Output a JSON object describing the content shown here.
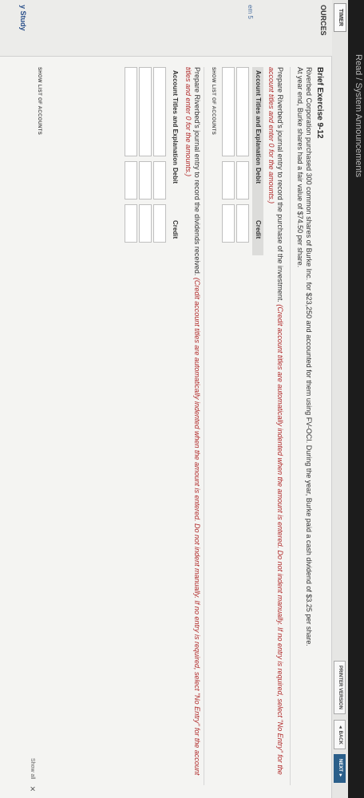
{
  "top": {
    "heading": "",
    "sub": "Read / System Announcements"
  },
  "header": {
    "timer": "TIMER",
    "printer": "PRINTER VERSION",
    "back": "◄ BACK",
    "next": "NEXT ►"
  },
  "sidebar": {
    "resources": "OURCES",
    "item": "em 5",
    "study": "y Study"
  },
  "content": {
    "title": "Brief Exercise 9-12",
    "para1": "Riverbed Corporation purchased 300 common shares of Burke Inc. for $23,250 and accounted for them using FV-OCI. During the year, Burke paid a cash dividend of $3.25 per share.",
    "para2": "At year end, Burke shares had a fair value of $74.50 per share.",
    "prompt1": "Prepare Riverbed's journal entry to record the purchase of the investment.",
    "instr1": "(Credit account titles are automatically indented when the amount is entered. Do not indent manually. If no entry is required, select \"No Entry\" for the account titles and enter 0 for the amounts.)",
    "prompt2": "Prepare Riverbed's journal entry to record the dividends received.",
    "instr2": "(Credit account titles are automatically indented when the amount is entered. Do not indent manually. If no entry is required, select \"No Entry\" for the account titles and enter 0 for the amounts.)",
    "col_account": "Account Titles and Explanation",
    "col_debit": "Debit",
    "col_credit": "Credit",
    "show_list": "SHOW LIST OF ACCOUNTS"
  },
  "footer": {
    "show_all": "Show all",
    "close": "×"
  }
}
